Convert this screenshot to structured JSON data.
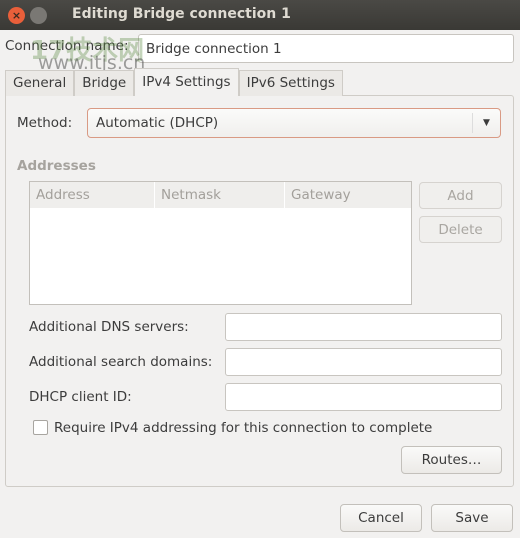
{
  "window": {
    "title": "Editing Bridge connection 1",
    "close_icon": "close-icon"
  },
  "watermark": {
    "text": "17技术网",
    "url": "www.itjs.cn"
  },
  "connection_name": {
    "label": "Connection name:",
    "value": "Bridge connection 1"
  },
  "tabs": [
    {
      "label": "General"
    },
    {
      "label": "Bridge"
    },
    {
      "label": "IPv4 Settings",
      "active": true
    },
    {
      "label": "IPv6 Settings"
    }
  ],
  "ipv4": {
    "method_label": "Method:",
    "method_value": "Automatic (DHCP)",
    "addresses_label": "Addresses",
    "columns": [
      "Address",
      "Netmask",
      "Gateway"
    ],
    "add": "Add",
    "delete": "Delete",
    "dns_label": "Additional DNS servers:",
    "dns_value": "",
    "search_label": "Additional search domains:",
    "search_value": "",
    "dhcp_label": "DHCP client ID:",
    "dhcp_value": "",
    "require_label": "Require IPv4 addressing for this connection to complete",
    "require_checked": false,
    "routes": "Routes…"
  },
  "footer": {
    "cancel": "Cancel",
    "save": "Save"
  },
  "colors": {
    "titlebar": "#3c3b37",
    "close": "#e95f3a",
    "focus_border": "#d99a84"
  }
}
